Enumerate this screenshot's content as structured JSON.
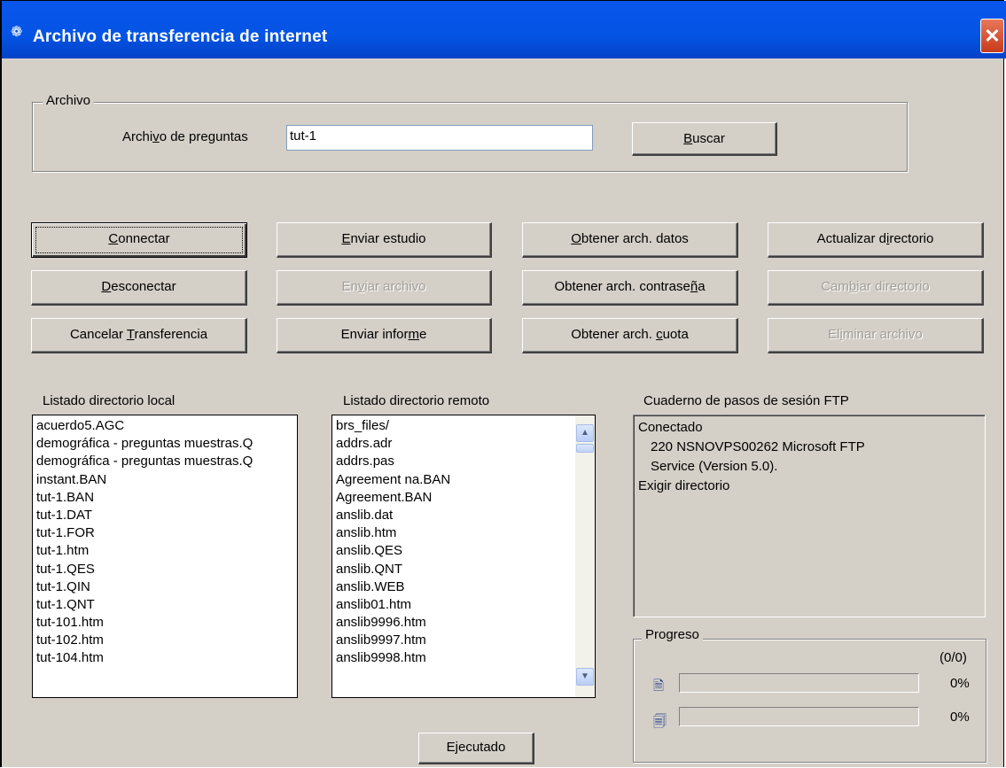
{
  "window": {
    "title": "Archivo de transferencia de internet",
    "title_icon": "ftp-icon",
    "close_label": "✕"
  },
  "file_group": {
    "legend": "Archivo",
    "question_file_label_pre": "Archi",
    "question_file_label_key": "v",
    "question_file_label_post": "o de preguntas",
    "question_file_value": "tut-1",
    "browse_pre": "",
    "browse_key": "B",
    "browse_post": "uscar"
  },
  "buttons": {
    "connect": {
      "pre": "",
      "key": "C",
      "post": "onnectar"
    },
    "send_study": {
      "pre": "",
      "key": "E",
      "post": "nviar estudio"
    },
    "get_data": {
      "pre": "",
      "key": "O",
      "post": "btener arch. datos"
    },
    "refresh_dir": {
      "pre": "Actualizar d",
      "key": "i",
      "post": "rectorio"
    },
    "disconnect": {
      "pre": "",
      "key": "D",
      "post": "esconectar"
    },
    "send_file": {
      "pre": "En",
      "key": "v",
      "post": "iar archivo"
    },
    "get_password": {
      "pre": "Obtener arch. contrase",
      "key": "ñ",
      "post": "a"
    },
    "change_dir": {
      "pre": "Cam",
      "key": "b",
      "post": "iar directorio"
    },
    "cancel_transfer": {
      "pre": "Cancelar ",
      "key": "T",
      "post": "ransferencia"
    },
    "send_report": {
      "pre": "Enviar infor",
      "key": "m",
      "post": "e"
    },
    "get_quota": {
      "pre": "Obtener arch. ",
      "key": "c",
      "post": "uota"
    },
    "delete_file": {
      "pre": "El",
      "key": "i",
      "post": "minar archivo"
    },
    "done": "Ejecutado"
  },
  "local_list": {
    "label": "Listado directorio local",
    "items": [
      "acuerdo5.AGC",
      "demográfica - preguntas muestras.Q",
      "demográfica - preguntas muestras.Q",
      "instant.BAN",
      "tut-1.BAN",
      "tut-1.DAT",
      "tut-1.FOR",
      "tut-1.htm",
      "tut-1.QES",
      "tut-1.QIN",
      "tut-1.QNT",
      "tut-101.htm",
      "tut-102.htm",
      "tut-104.htm"
    ]
  },
  "remote_list": {
    "label": "Listado directorio remoto",
    "items": [
      "brs_files/",
      "addrs.adr",
      "addrs.pas",
      "Agreement na.BAN",
      "Agreement.BAN",
      "anslib.dat",
      "anslib.htm",
      "anslib.QES",
      "anslib.QNT",
      "anslib.WEB",
      "anslib01.htm",
      "anslib9996.htm",
      "anslib9997.htm",
      "anslib9998.htm"
    ]
  },
  "log": {
    "label": "Cuaderno de pasos de sesión FTP",
    "lines": [
      "Conectado",
      "220 NSNOVPS00262 Microsoft FTP",
      "Service (Version 5.0).",
      "Exigir directorio"
    ]
  },
  "progress": {
    "legend": "Progreso",
    "count": "(0/0)",
    "file_percent_text": "0%",
    "file_fraction": 0,
    "total_percent_text": "0%",
    "total_fraction": 0
  }
}
